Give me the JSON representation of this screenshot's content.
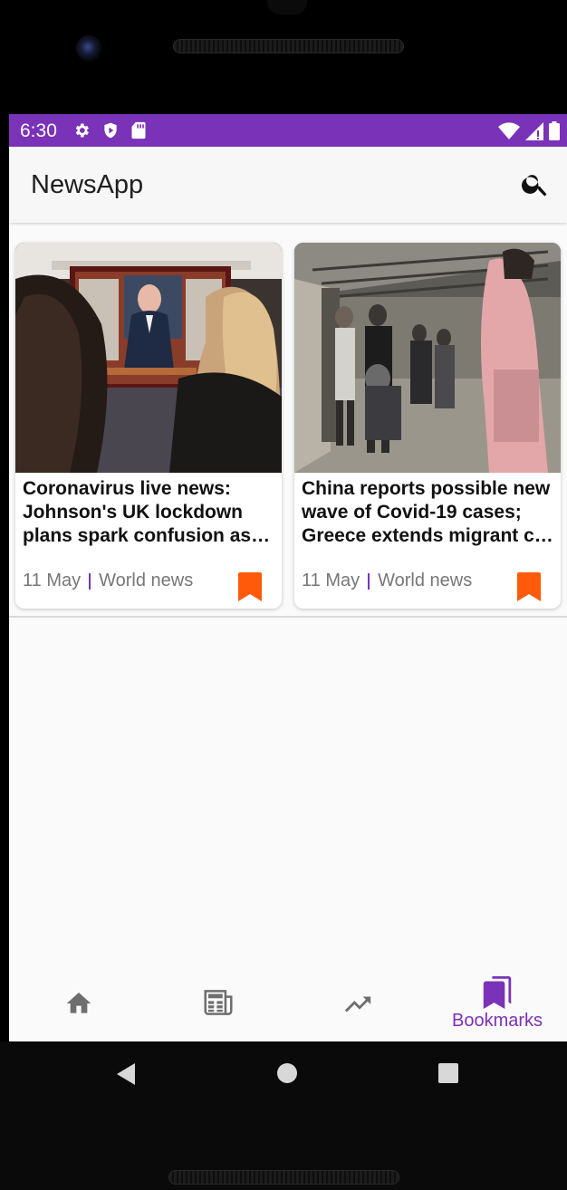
{
  "status_bar": {
    "time": "6:30",
    "left_icons": [
      "gear-icon",
      "shield-icon",
      "sd-card-icon"
    ],
    "right_icons": [
      "wifi-icon",
      "signal-icon",
      "battery-icon"
    ],
    "color": "#7a32b8"
  },
  "app_bar": {
    "title": "NewsApp",
    "search_icon": "search-icon"
  },
  "articles": [
    {
      "title": "Coronavirus live news: Johnson's UK lockdown plans spark confusion as …",
      "date": "11 May",
      "category": "World news",
      "bookmarked": true,
      "image": "news-photo-tv-address"
    },
    {
      "title": "China reports possible new wave of Covid-19 cases; Greece extends migrant c…",
      "date": "11 May",
      "category": "World news",
      "bookmarked": true,
      "image": "news-photo-street-crowd"
    }
  ],
  "bottom_nav": {
    "items": [
      {
        "icon": "home-icon",
        "label": "",
        "active": false
      },
      {
        "icon": "newspaper-icon",
        "label": "",
        "active": false
      },
      {
        "icon": "trending-icon",
        "label": "",
        "active": false
      },
      {
        "icon": "bookmarks-icon",
        "label": "Bookmarks",
        "active": true
      }
    ],
    "active_color": "#7a32b8",
    "inactive_color": "#6e6e6e"
  },
  "colors": {
    "accent": "#7a32b8",
    "bookmark": "#ff5a0a"
  }
}
